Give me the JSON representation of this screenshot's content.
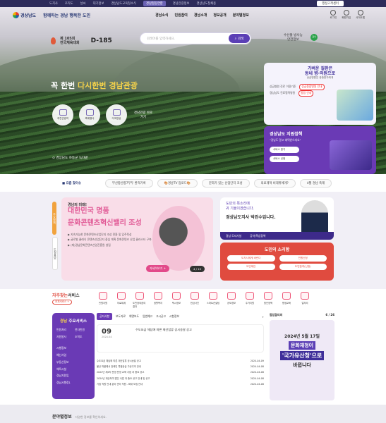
{
  "topbar": {
    "items": [
      "도지사",
      "조직도",
      "날씨",
      "대기정보",
      "경상남도교육청소식",
      "경남협동연합",
      "경남관광정보",
      "경상남도청채용"
    ],
    "right_btn": "행정고객센터"
  },
  "header": {
    "logo_name": "경상남도",
    "logo_sub": "GYEONGNAM",
    "slogan": "함께하는 경남 행복한 도민",
    "menu": [
      "경남소식",
      "민원참여",
      "경남소개",
      "정보공개",
      "분야별정보"
    ],
    "icons": [
      {
        "name": "login-icon",
        "label": "로그인"
      },
      {
        "name": "signup-icon",
        "label": "회원가입"
      },
      {
        "name": "sitemap-icon",
        "label": "사이트맵"
      }
    ]
  },
  "event": {
    "line1": "제 105회",
    "line2": "전국체육대회",
    "dday": "D-185"
  },
  "search": {
    "placeholder": "검색어를 입력하세요.",
    "button": "검색"
  },
  "water": {
    "line1": "수산물 방사능",
    "line2": "안전정보",
    "badge": "검사"
  },
  "hero": {
    "headline_pre": "꼭 한번 ",
    "headline_hl": "다시한번 경남관광",
    "quick_links": [
      {
        "icon": "cable-car-icon",
        "label": "추천관광지"
      },
      {
        "icon": "festival-icon",
        "label": "축제행사"
      },
      {
        "icon": "video-icon",
        "label": "이색영상"
      }
    ],
    "text_link": "경남관광 바로가기",
    "caption": "경상남도 하동군 녹차밭"
  },
  "side": {
    "card1": {
      "title1": "가벼운 질환은",
      "title2": "동네 병·의원으로",
      "sub": "상급병원은 중증환자에게",
      "rows": [
        {
          "label": "상급병원 진료 이용기준",
          "chip": "상급종합병원 안내"
        },
        {
          "label": "경상남도 진료협력병원",
          "chip": "종합 안내"
        }
      ]
    },
    "card2": {
      "title": "경상남도 지원정책",
      "sub": "\"경남도 알고 혜택받으세요\"",
      "btn1": "서비스 찾기",
      "btn2": "서비스 신청"
    }
  },
  "ticker": {
    "label": "요즘 찾이슈",
    "items": [
      "부산항산항7부두 환적기록",
      "🎨경남TV 업로드🎨",
      "문화가 있는 산업단지 조성",
      "의료개혁 비대위에게?",
      "4월 경남 축제"
    ]
  },
  "tabs_v": [
    "주요정책",
    "도정홍보"
  ],
  "banner": {
    "t1": "경남의 미래!",
    "t2": "대한민국 명품",
    "t3": "문화콘텐츠혁신밸리 조성",
    "items": [
      "▶ 지속가능한 문화콘텐츠산업단지 조성 전환 및 입주육성",
      "▶ 글로벌 클래식 콘텐츠산업단지 중심 계획 문화콘텐츠 산업 클러스터 구축",
      "▶ (재)경남문화콘텐츠산업진흥원 설립"
    ],
    "more": "자세히보기 +",
    "page": "4 / 10"
  },
  "governor": {
    "line1": "도민의 목소리에",
    "line2": "귀 기울이겠습니다.",
    "sign": "경상남도지사 박완수입니다.",
    "bar": [
      "경남 도지사실",
      "공약/핵심정책"
    ]
  },
  "voice": {
    "title": "도민의 소리함",
    "items": [
      "도지사에게 바란다",
      "민원신청",
      "도민제안",
      "도민참여(신청)"
    ]
  },
  "frequent": {
    "title_red": "자주찾는",
    "title": "서비스",
    "all": "전체서비스 +",
    "items": [
      "민원지원",
      "의료체계",
      "도민창여참여결과",
      "생활복지",
      "택시정보",
      "헌금사진",
      "스마트컨설팅",
      "공모경보",
      "주거지원",
      "청년정책",
      "평생교육",
      "일자리"
    ]
  },
  "mainsvc": {
    "title_hl": "경남",
    "title": "주요서비스",
    "opts": [
      "민원처리",
      "전자민원",
      "자원봉사",
      "조직도"
    ],
    "list": [
      "시행정보",
      "예산사업",
      "부동산정보",
      "체육시설",
      "경남지원입",
      "경남시행정1"
    ]
  },
  "news": {
    "tabs": [
      "공지사항",
      "보도자료",
      "해명보도",
      "입법예고",
      "고시공고",
      "시험정보"
    ],
    "more": "+",
    "feat_day": "09",
    "feat_month": "2024.04",
    "feat_title": "수도요금 체납에 따른 재산압류 공시송달 공고",
    "rows": [
      {
        "t": "수도요금 체납에 따른 재산압류 공시송달 공고",
        "d": "2024-04-09"
      },
      {
        "t": "불산 마을에서 장애인 특별공급 가공주의 안내",
        "d": "2024-04-08"
      },
      {
        "t": "2024년 제4차 운영 운영 교육 사업 과 중요 공고",
        "d": "2024-04-08"
      },
      {
        "t": "2024년 계산하여 법인 사업 과 중요 공고 안내 및 공고",
        "d": "2024-04-08"
      },
      {
        "t": "기업 직원 안내 분야 관리 직원 - 확대 모집 안내",
        "d": "2024-04-08"
      }
    ]
  },
  "popup": {
    "title": "팝업알리미",
    "page": "6 / 26",
    "date": "2024년 5월 17일",
    "a": "문화재청이",
    "b": "'국가유산청'으로",
    "c": "바뀝니다"
  },
  "section3": {
    "title": "분야별정보",
    "sub": "다양한 정보를 확인하세요."
  }
}
